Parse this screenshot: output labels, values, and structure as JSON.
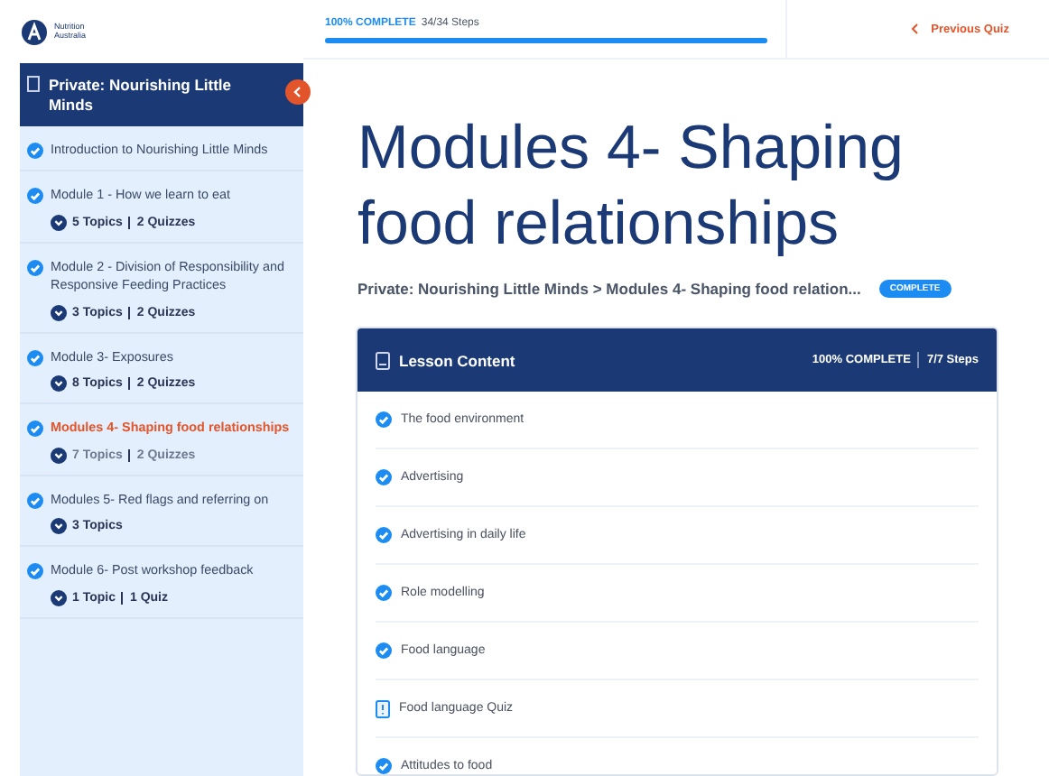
{
  "logo": {
    "text": "Nutrition Australia"
  },
  "progress": {
    "label": "100% COMPLETE",
    "steps": "34/34 Steps",
    "level": 1
  },
  "previous": {
    "label": "Previous Quiz"
  },
  "sidebar": {
    "title": "Private: Nourishing Little Minds",
    "items": [
      {
        "title": "Introduction to Nourishing Little Minds",
        "completed": true,
        "selected": false
      },
      {
        "title": "Module 1 - How we learn to eat",
        "completed": true,
        "selected": false,
        "meta": [
          "5 Topics",
          "2 Quizzes"
        ]
      },
      {
        "title": "Module 2 - Division of Responsibility and Responsive Feeding Practices",
        "completed": true,
        "selected": false,
        "meta": [
          "3 Topics",
          "2 Quizzes"
        ]
      },
      {
        "title": "Module 3- Exposures",
        "completed": true,
        "selected": false,
        "meta": [
          "8 Topics",
          "2 Quizzes"
        ]
      },
      {
        "title": "Modules 4- Shaping food relationships",
        "completed": true,
        "selected": true,
        "meta": [
          "7 Topics",
          "2 Quizzes"
        ]
      },
      {
        "title": "Modules 5- Red flags and referring on",
        "completed": true,
        "selected": false,
        "meta": [
          "3 Topics"
        ]
      },
      {
        "title": "Module 6- Post workshop feedback",
        "completed": true,
        "selected": false,
        "meta": [
          "1 Topic",
          "1 Quiz"
        ]
      }
    ]
  },
  "page": {
    "title": "Modules 4- Shaping food relationships",
    "breadcrumb": "Private: Nourishing Little Minds > Modules 4- Shaping food relation...",
    "status": "COMPLETE"
  },
  "lesson_content": {
    "title": "Lesson Content",
    "complete": "100% COMPLETE",
    "steps": "7/7 Steps",
    "items": [
      {
        "kind": "topic",
        "title": "The food environment",
        "completed": true
      },
      {
        "kind": "topic",
        "title": "Advertising",
        "completed": true
      },
      {
        "kind": "topic",
        "title": "Advertising in daily life",
        "completed": true
      },
      {
        "kind": "topic",
        "title": "Role modelling",
        "completed": true
      },
      {
        "kind": "topic",
        "title": "Food language",
        "completed": true
      },
      {
        "kind": "quiz",
        "title": "Food language Quiz",
        "completed": true
      },
      {
        "kind": "topic",
        "title": "Attitudes to food",
        "completed": true
      }
    ]
  }
}
